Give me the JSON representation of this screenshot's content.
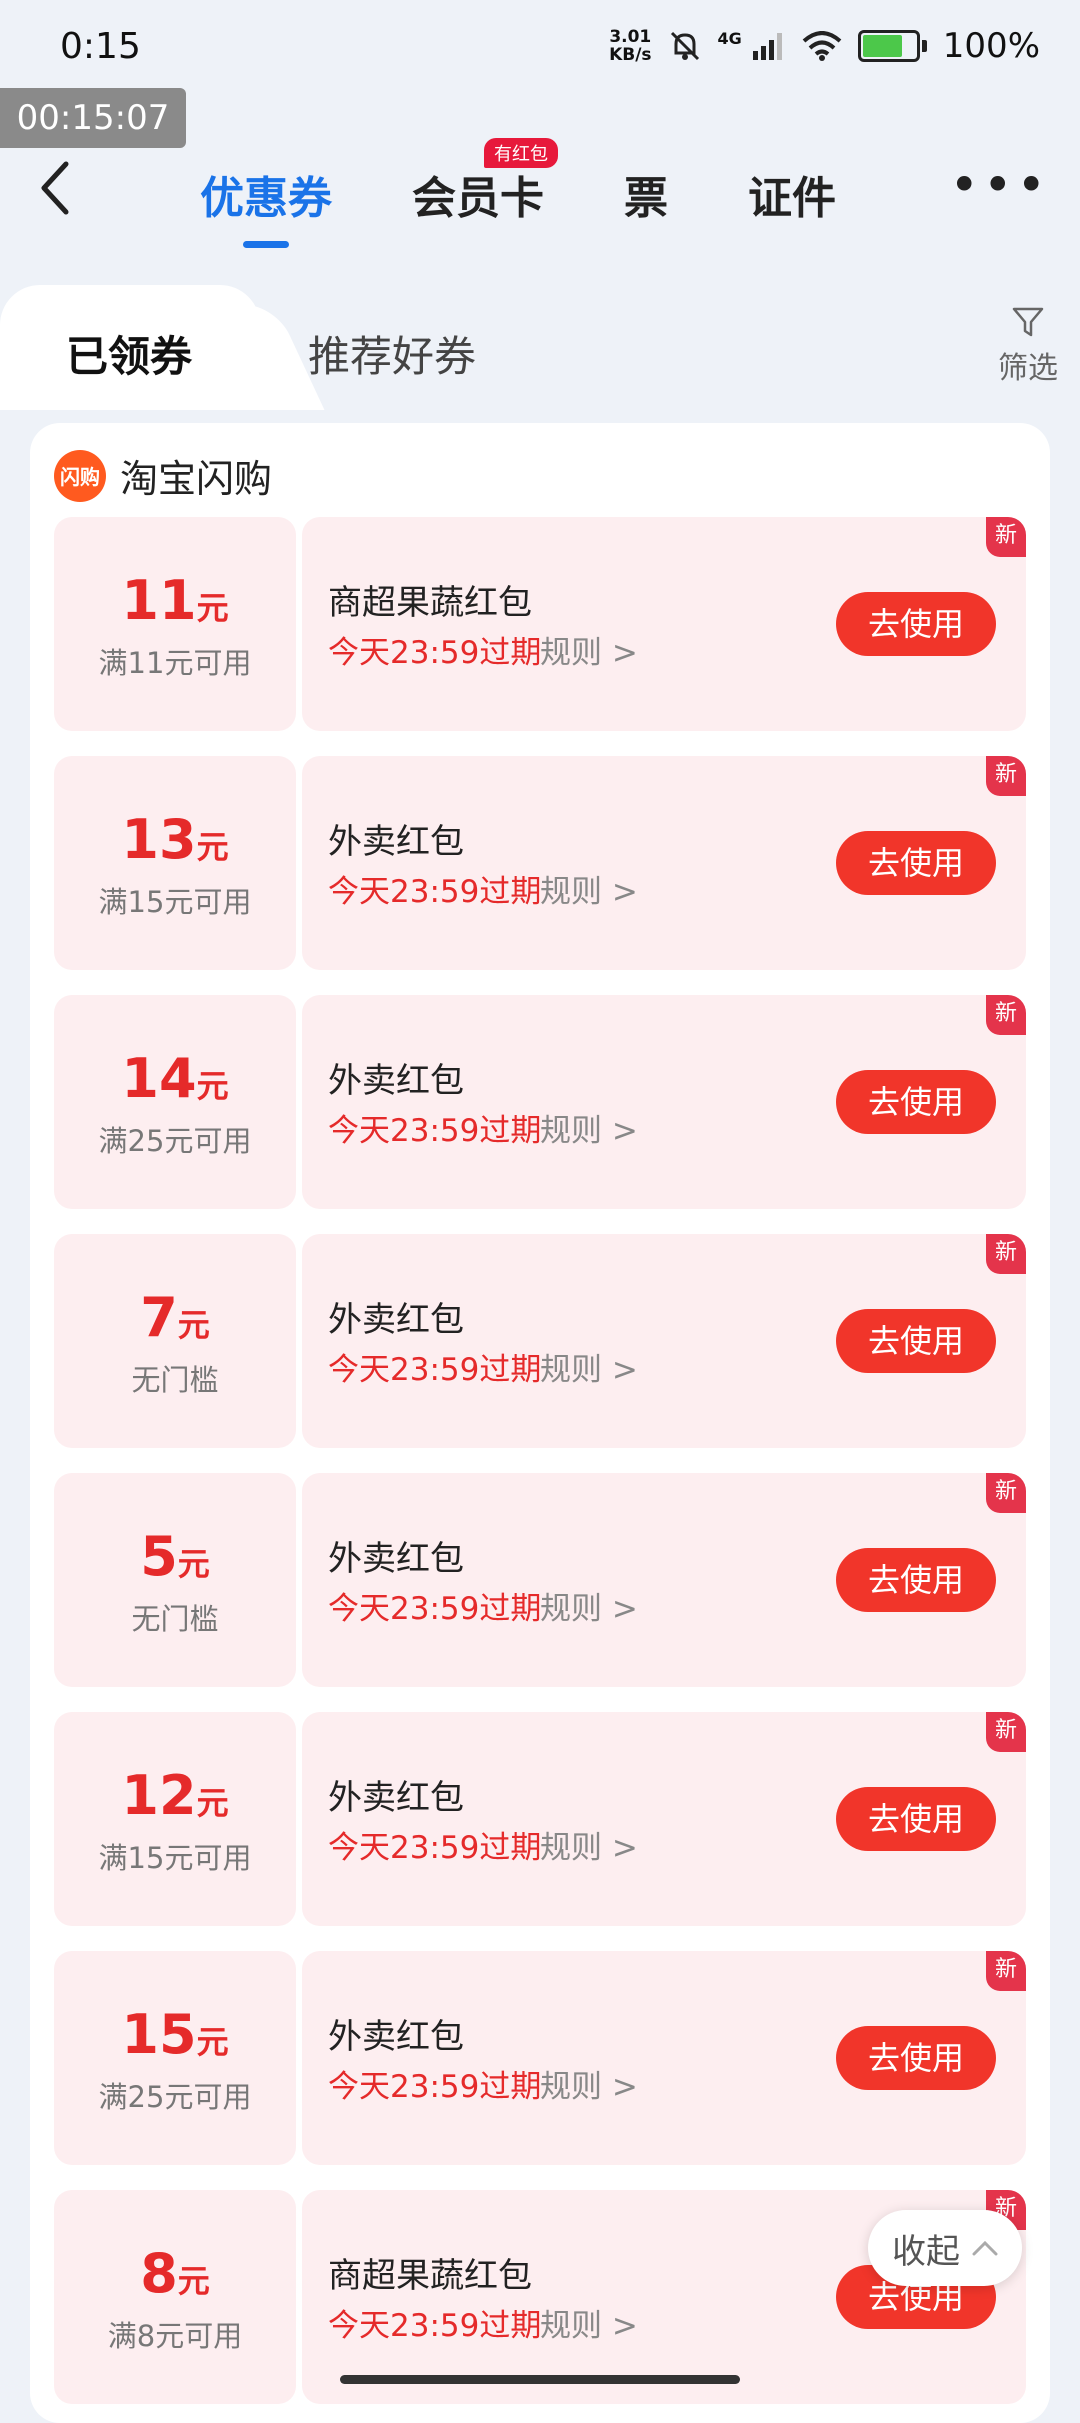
{
  "status_bar": {
    "time": "0:15",
    "net_speed_value": "3.01",
    "net_speed_unit": "KB/s",
    "network": "4G",
    "battery": "100%"
  },
  "timer_overlay": "00:15:07",
  "top_tabs": [
    {
      "label": "优惠券",
      "active": true
    },
    {
      "label": "会员卡",
      "badge": "有红包"
    },
    {
      "label": "票"
    },
    {
      "label": "证件"
    }
  ],
  "sub_tabs": {
    "active": "已领券",
    "other": "推荐好券"
  },
  "filter_label": "筛选",
  "brand": {
    "logo_text": "闪购",
    "name": "淘宝闪购"
  },
  "coupons": [
    {
      "amount": "11",
      "unit": "元",
      "condition": "满11元可用",
      "title": "商超果蔬红包",
      "expiry": "今天23:59过期",
      "rule": "规则",
      "button": "去使用",
      "tag": "新"
    },
    {
      "amount": "13",
      "unit": "元",
      "condition": "满15元可用",
      "title": "外卖红包",
      "expiry": "今天23:59过期",
      "rule": "规则",
      "button": "去使用",
      "tag": "新"
    },
    {
      "amount": "14",
      "unit": "元",
      "condition": "满25元可用",
      "title": "外卖红包",
      "expiry": "今天23:59过期",
      "rule": "规则",
      "button": "去使用",
      "tag": "新"
    },
    {
      "amount": "7",
      "unit": "元",
      "condition": "无门槛",
      "title": "外卖红包",
      "expiry": "今天23:59过期",
      "rule": "规则",
      "button": "去使用",
      "tag": "新"
    },
    {
      "amount": "5",
      "unit": "元",
      "condition": "无门槛",
      "title": "外卖红包",
      "expiry": "今天23:59过期",
      "rule": "规则",
      "button": "去使用",
      "tag": "新"
    },
    {
      "amount": "12",
      "unit": "元",
      "condition": "满15元可用",
      "title": "外卖红包",
      "expiry": "今天23:59过期",
      "rule": "规则",
      "button": "去使用",
      "tag": "新"
    },
    {
      "amount": "15",
      "unit": "元",
      "condition": "满25元可用",
      "title": "外卖红包",
      "expiry": "今天23:59过期",
      "rule": "规则",
      "button": "去使用",
      "tag": "新"
    },
    {
      "amount": "8",
      "unit": "元",
      "condition": "满8元可用",
      "title": "商超果蔬红包",
      "expiry": "今天23:59过期",
      "rule": "规则",
      "button": "去使用",
      "tag": "新"
    }
  ],
  "collapse_label": "收起",
  "colors": {
    "accent_blue": "#1a73e8",
    "coupon_red": "#e52a2a",
    "button_red": "#f1352a",
    "coupon_bg": "#fdeef0"
  }
}
